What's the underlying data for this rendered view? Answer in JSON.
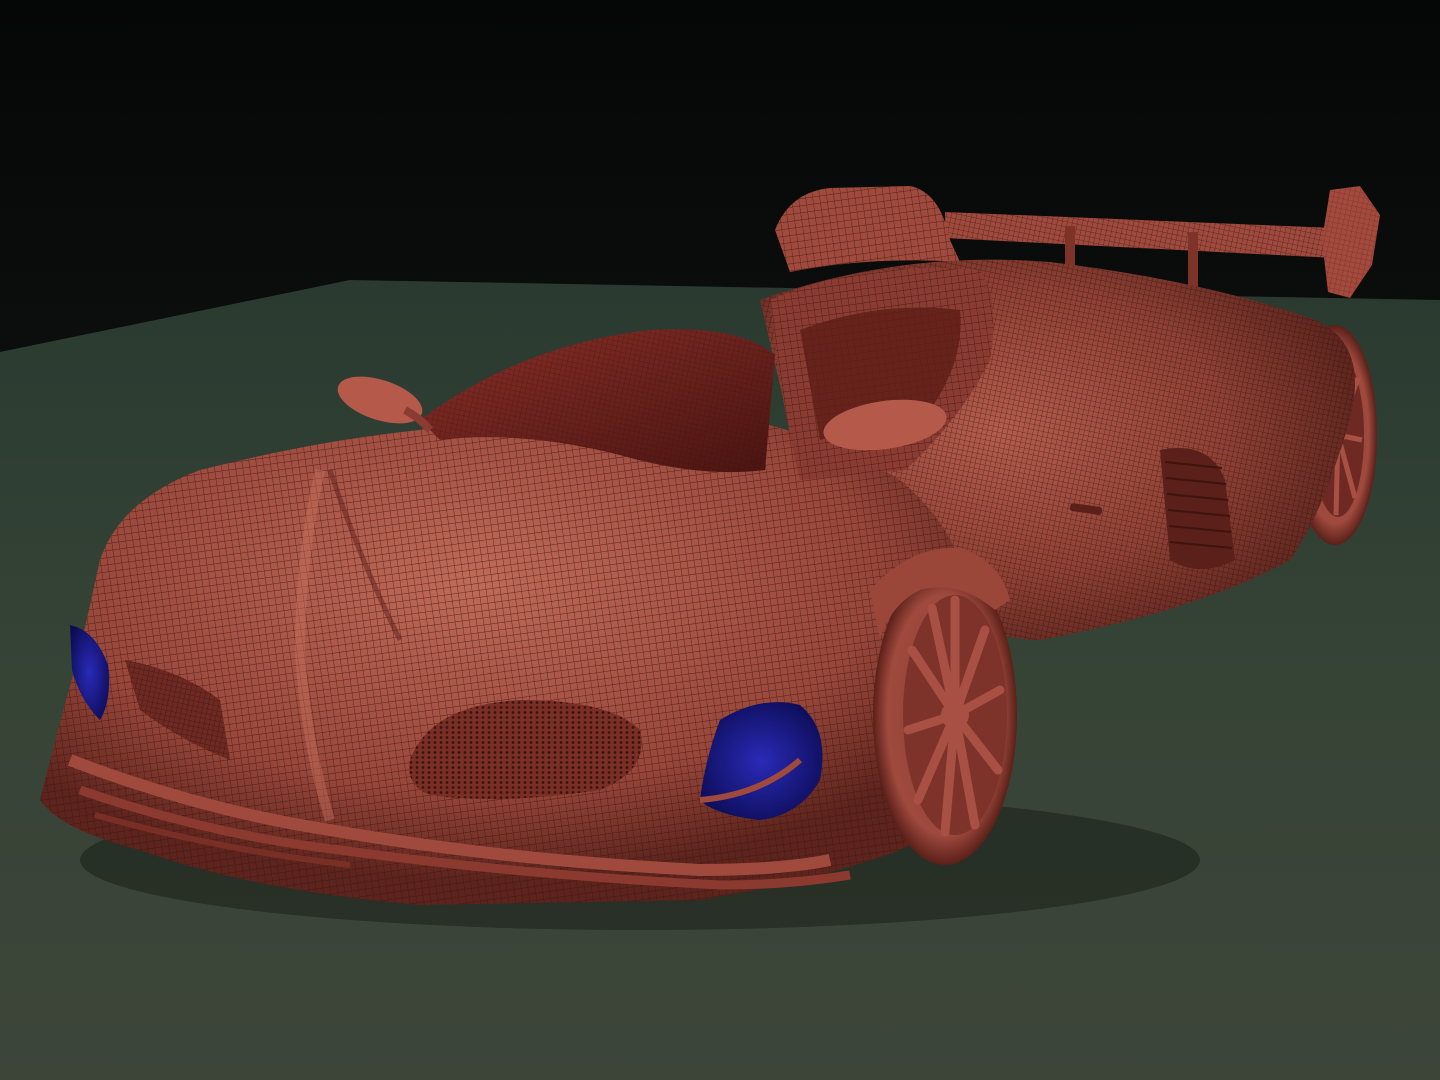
{
  "viewport": {
    "subject": "car-sculpt-model",
    "colors": {
      "background_top": "#050606",
      "background_bottom": "#1b201d",
      "ground_far": "#2f3d33",
      "ground_near": "#3a4438",
      "body_light": "#b0584a",
      "body_mid": "#8a3c32",
      "body_dark": "#4a1c17",
      "wire": "#3a130e",
      "glass": "#6e1d1a",
      "intake_blue": "#1a1a8c"
    }
  }
}
